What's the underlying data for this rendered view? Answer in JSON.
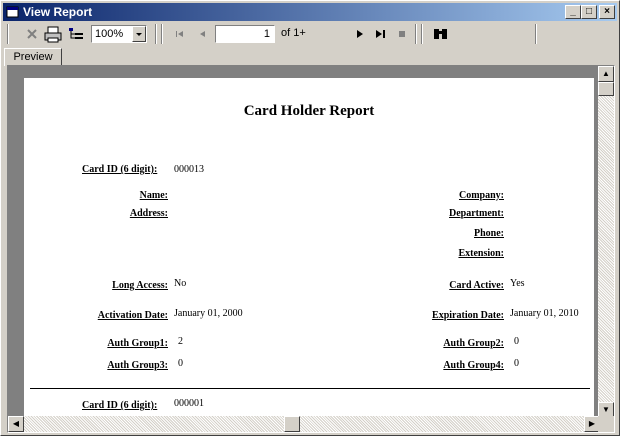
{
  "window": {
    "title": "View Report"
  },
  "titlebar_buttons": [
    "_",
    "□",
    "×"
  ],
  "toolbar": {
    "zoom": "100%",
    "page": "1",
    "of_pages": "of 1+"
  },
  "tabs": [
    {
      "label": "Preview"
    }
  ],
  "report": {
    "title": "Card Holder Report",
    "record1": {
      "card_id_label": "Card ID (6 digit):",
      "card_id": "000013",
      "name_label": "Name:",
      "address_label": "Address:",
      "company_label": "Company:",
      "department_label": "Department:",
      "phone_label": "Phone:",
      "extension_label": "Extension:",
      "long_access_label": "Long Access:",
      "long_access": "No",
      "card_active_label": "Card Active:",
      "card_active": "Yes",
      "activation_label": "Activation Date:",
      "activation": "January 01, 2000",
      "expiration_label": "Expiration Date:",
      "expiration": "January 01, 2010",
      "ag1_label": "Auth Group1:",
      "ag1": "2",
      "ag2_label": "Auth Group2:",
      "ag2": "0",
      "ag3_label": "Auth Group3:",
      "ag3": "0",
      "ag4_label": "Auth Group4:",
      "ag4": "0"
    },
    "record2": {
      "card_id_label": "Card ID (6 digit):",
      "card_id": "000001"
    }
  }
}
